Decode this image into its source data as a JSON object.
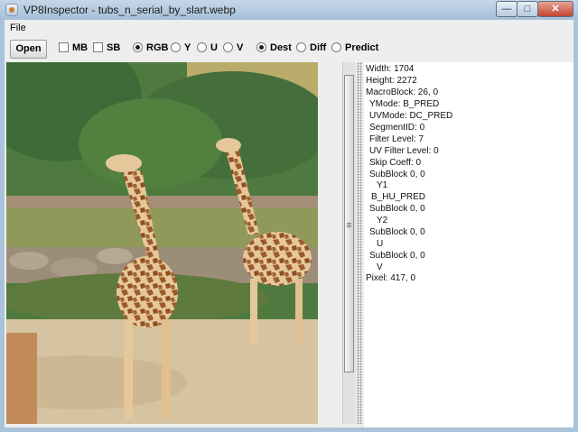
{
  "window": {
    "title": "VP8Inspector - tubs_n_serial_by_slart.webp",
    "minimize_glyph": "—",
    "maximize_glyph": "□",
    "close_glyph": "✕"
  },
  "menu": {
    "file_label": "File"
  },
  "toolbar": {
    "open_label": "Open",
    "checkboxes": [
      {
        "label": "MB",
        "checked": false
      },
      {
        "label": "SB",
        "checked": false
      }
    ],
    "channel_radios": [
      {
        "label": "RGB",
        "selected": true
      },
      {
        "label": "Y",
        "selected": false
      },
      {
        "label": "U",
        "selected": false
      },
      {
        "label": "V",
        "selected": false
      }
    ],
    "view_radios": [
      {
        "label": "Dest",
        "selected": true
      },
      {
        "label": "Diff",
        "selected": false
      },
      {
        "label": "Predict",
        "selected": false
      }
    ]
  },
  "info": {
    "lines": [
      "Width: 1704",
      "Height: 2272",
      "MacroBlock: 26, 0",
      " YMode: B_PRED",
      " UVMode: DC_PRED",
      " SegmentID: 0",
      " Filter Level: 7",
      " UV Filter Level: 0",
      " Skip Coeff: 0",
      " SubBlock 0, 0",
      "    Y1",
      "  B_HU_PRED",
      " SubBlock 0, 0",
      "    Y2",
      " SubBlock 0, 0",
      "    U",
      " SubBlock 0, 0",
      "    V",
      "Pixel: 417, 0"
    ]
  },
  "colors": {
    "title_bar": "#a9c3da",
    "window_bg": "#eeeeee",
    "close_button": "#c2452f",
    "info_bg": "#ffffff"
  },
  "icons": {
    "app": "app-icon",
    "scroll_grip": "grip-icon"
  }
}
